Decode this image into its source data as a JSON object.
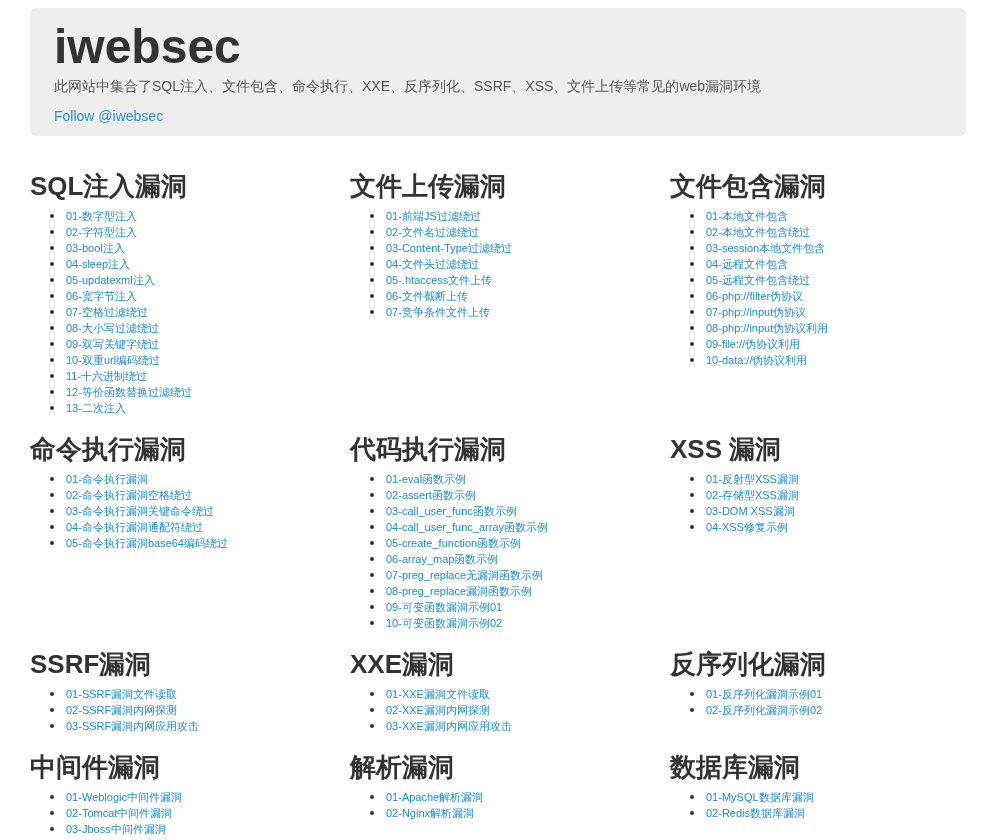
{
  "header": {
    "title": "iwebsec",
    "description": "此网站中集合了SQL注入、文件包含、命令执行、XXE、反序列化、SSRF、XSS、文件上传等常见的web漏洞环境",
    "follow_link": "Follow @iwebsec"
  },
  "sections": [
    {
      "title": "SQL注入漏洞",
      "items": [
        "01-数字型注入",
        "02-字符型注入",
        "03-bool注入",
        "04-sleep注入",
        "05-updatexml注入",
        "06-宽字节注入",
        "07-空格过滤绕过",
        "08-大小写过滤绕过",
        "09-双写关键字绕过",
        "10-双重url编码绕过",
        "11-十六进制绕过",
        "12-等价函数替换过滤绕过",
        "13-二次注入"
      ]
    },
    {
      "title": "文件上传漏洞",
      "items": [
        "01-前端JS过滤绕过",
        "02-文件名过滤绕过",
        "03-Content-Type过滤绕过",
        "04-文件头过滤绕过",
        "05-.htaccess文件上传",
        "06-文件截断上传",
        "07-竞争条件文件上传"
      ]
    },
    {
      "title": "文件包含漏洞",
      "items": [
        "01-本地文件包含",
        "02-本地文件包含绕过",
        "03-session本地文件包含",
        "04-远程文件包含",
        "05-远程文件包含绕过",
        "06-php://filter伪协议",
        "07-php://input伪协议",
        "08-php://input伪协议利用",
        "09-file://伪协议利用",
        "10-data://伪协议利用"
      ]
    },
    {
      "title": "命令执行漏洞",
      "items": [
        "01-命令执行漏洞",
        "02-命令执行漏洞空格绕过",
        "03-命令执行漏洞关键命令绕过",
        "04-命令执行漏洞通配符绕过",
        "05-命令执行漏洞base64编码绕过"
      ]
    },
    {
      "title": "代码执行漏洞",
      "items": [
        "01-eval函数示例",
        "02-assert函数示例",
        "03-call_user_func函数示例",
        "04-call_user_func_array函数示例",
        "05-create_function函数示例",
        "06-array_map函数示例",
        "07-preg_replace无漏洞函数示例",
        "08-preg_replace漏洞函数示例",
        "09-可变函数漏洞示例01",
        "10-可变函数漏洞示例02"
      ]
    },
    {
      "title": "XSS 漏洞",
      "items": [
        "01-反射型XSS漏洞",
        "02-存储型XSS漏洞",
        "03-DOM XSS漏洞",
        "04-XSS修复示例"
      ]
    },
    {
      "title": "SSRF漏洞",
      "items": [
        "01-SSRF漏洞文件读取",
        "02-SSRF漏洞内网探测",
        "03-SSRF漏洞内网应用攻击"
      ]
    },
    {
      "title": "XXE漏洞",
      "items": [
        "01-XXE漏洞文件读取",
        "02-XXE漏洞内网探测",
        "03-XXE漏洞内网应用攻击"
      ]
    },
    {
      "title": "反序列化漏洞",
      "items": [
        "01-反序列化漏洞示例01",
        "02-反序列化漏洞示例02"
      ]
    },
    {
      "title": "中间件漏洞",
      "items": [
        "01-Weblogic中间件漏洞",
        "02-Tomcat中间件漏洞",
        "03-Jboss中间件漏洞"
      ]
    },
    {
      "title": "解析漏洞",
      "items": [
        "01-Apache解析漏洞",
        "02-Nginx解析漏洞"
      ]
    },
    {
      "title": "数据库漏洞",
      "items": [
        "01-MySQL数据库漏洞",
        "02-Redis数据库漏洞"
      ]
    }
  ]
}
